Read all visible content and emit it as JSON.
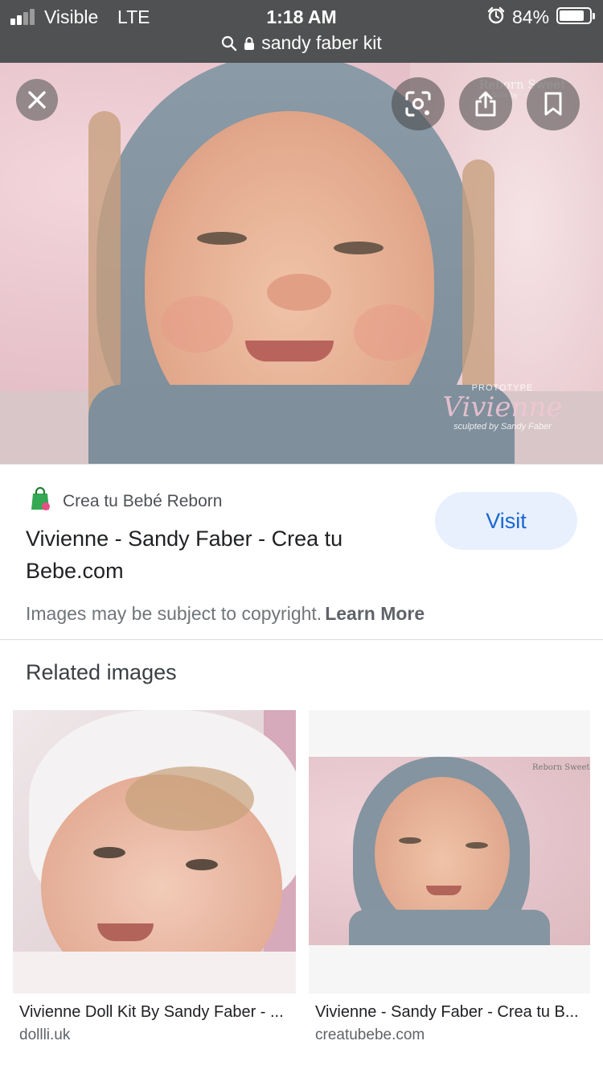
{
  "status_bar": {
    "carrier": "Visible",
    "network": "LTE",
    "time": "1:18 AM",
    "battery_percent": "84%",
    "battery_level": 0.84,
    "signal_bars_active": 2,
    "signal_bars_total": 4
  },
  "url_bar": {
    "query": "sandy faber kit",
    "icons": [
      "search-icon",
      "lock-icon"
    ]
  },
  "hero": {
    "watermark_prototype": "PROTOTYPE",
    "watermark_name": "Vivienne",
    "watermark_sculpted": "sculpted by Sandy Faber",
    "brand_logo": "Reborn Sweet",
    "brand_logo_sub": "Art Dolls by",
    "buttons": [
      "close-icon",
      "lens-icon",
      "share-icon",
      "bookmark-icon"
    ]
  },
  "result": {
    "source_name": "Crea tu Bebé Reborn",
    "title": "Vivienne - Sandy Faber - Crea tu Bebe.com",
    "visit_label": "Visit",
    "copyright_text": "Images may be subject to copyright.",
    "learn_more_label": "Learn More"
  },
  "related": {
    "heading": "Related images",
    "items": [
      {
        "title": "Vivienne Doll Kit By Sandy Faber - ...",
        "source": "dollli.uk"
      },
      {
        "title": "Vivienne - Sandy Faber - Crea tu B...",
        "source": "creatubebe.com",
        "image_watermark": "Reborn Sweet"
      }
    ]
  },
  "colors": {
    "topbar": "#505152",
    "visit_bg": "#e8f0fe",
    "visit_text": "#1967d2",
    "source_icon": "#34a853"
  }
}
